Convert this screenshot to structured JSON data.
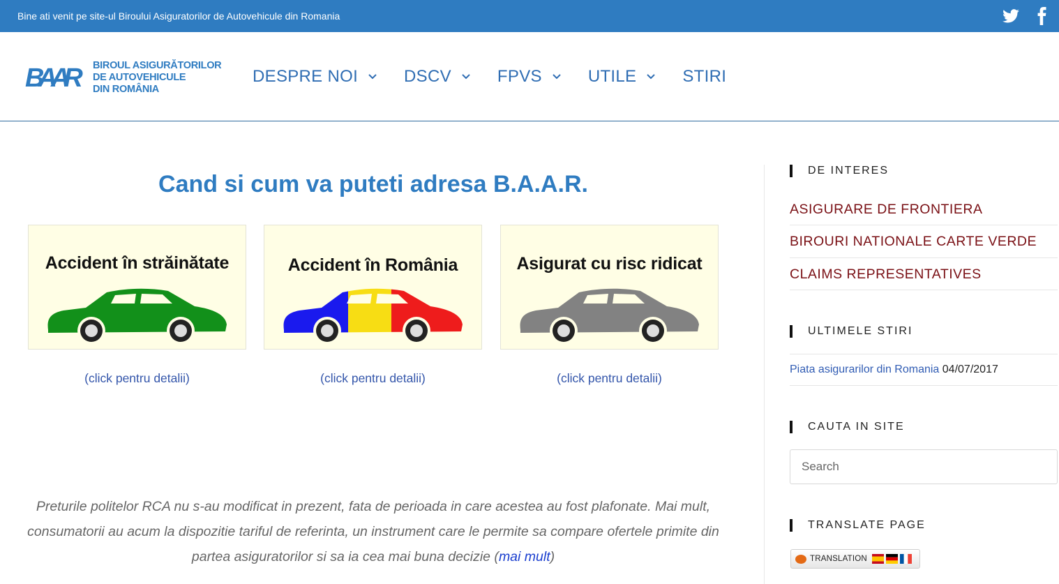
{
  "topbar": {
    "welcome": "Bine ati venit pe site-ul Biroului Asiguratorilor de Autovehicule din Romania",
    "social": [
      "twitter-icon",
      "facebook-icon"
    ]
  },
  "logo": {
    "mark": "BAAR",
    "line1": "BIROUL ASIGURĂTORILOR",
    "line2": "DE AUTOVEHICULE",
    "line3": "DIN ROMÂNIA"
  },
  "nav": [
    {
      "label": "DESPRE NOI"
    },
    {
      "label": "DSCV"
    },
    {
      "label": "FPVS"
    },
    {
      "label": "UTILE"
    },
    {
      "label": "STIRI"
    }
  ],
  "main": {
    "title": "Cand si cum va puteti adresa B.A.A.R.",
    "cards": [
      {
        "title": "Accident în străinătate",
        "details": "(click pentru detalii)",
        "car_color": "#12901a"
      },
      {
        "title": "Accident în România",
        "details": "(click pentru detalii)",
        "car_colors": [
          "#1a1aee",
          "#f7dd14",
          "#ee1c1c"
        ]
      },
      {
        "title": "Asigurat cu risc ridicat",
        "details": "(click pentru detalii)",
        "car_color": "#828282"
      }
    ],
    "paragraph": "Preturile politelor RCA nu s-au modificat in prezent, fata de perioada in care acestea au fost plafonate. Mai mult, consumatorii au acum la dispozitie tariful de referinta, un instrument care le permite sa compare ofertele primite din partea asiguratorilor si sa ia cea mai buna decizie (",
    "more_link": "mai mult",
    "paragraph_end": ")"
  },
  "sidebar": {
    "interest_title": "DE INTERES",
    "interest_links": [
      "ASIGURARE DE FRONTIERA",
      "BIROURI NATIONALE CARTE VERDE",
      "CLAIMS REPRESENTATIVES"
    ],
    "news_title": "ULTIMELE STIRI",
    "news_item": "Piata asigurarilor din Romania",
    "news_date": "04/07/2017",
    "search_title": "CAUTA IN SITE",
    "search_placeholder": "Search",
    "translate_title": "TRANSLATE PAGE",
    "translate_label": "TRANSLATION"
  },
  "colors": {
    "topbar": "#2f7cc1",
    "nav_text": "#2f6db3",
    "title": "#2f7cc1",
    "sidebar_link": "#7a1015"
  }
}
